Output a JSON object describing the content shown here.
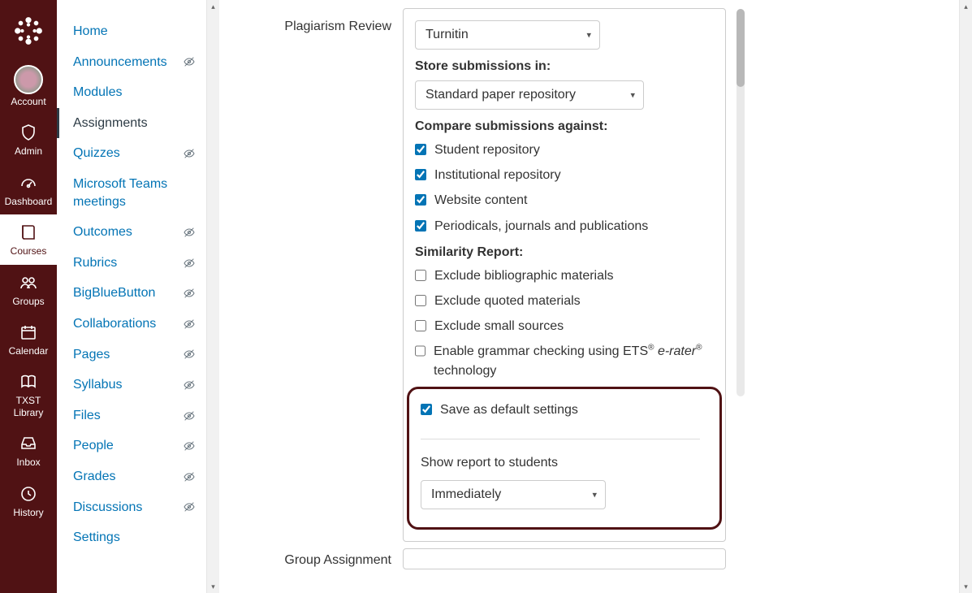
{
  "global_nav": {
    "items": [
      {
        "key": "account",
        "label": "Account"
      },
      {
        "key": "admin",
        "label": "Admin"
      },
      {
        "key": "dashboard",
        "label": "Dashboard"
      },
      {
        "key": "courses",
        "label": "Courses",
        "active": true
      },
      {
        "key": "groups",
        "label": "Groups"
      },
      {
        "key": "calendar",
        "label": "Calendar"
      },
      {
        "key": "library",
        "label": "TXST\nLibrary"
      },
      {
        "key": "inbox",
        "label": "Inbox"
      },
      {
        "key": "history",
        "label": "History"
      }
    ]
  },
  "course_nav": [
    {
      "label": "Home",
      "hidden": false
    },
    {
      "label": "Announcements",
      "hidden": true
    },
    {
      "label": "Modules",
      "hidden": false
    },
    {
      "label": "Assignments",
      "hidden": false,
      "active": true
    },
    {
      "label": "Quizzes",
      "hidden": true
    },
    {
      "label": "Microsoft Teams meetings",
      "hidden": false
    },
    {
      "label": "Outcomes",
      "hidden": true
    },
    {
      "label": "Rubrics",
      "hidden": true
    },
    {
      "label": "BigBlueButton",
      "hidden": true
    },
    {
      "label": "Collaborations",
      "hidden": true
    },
    {
      "label": "Pages",
      "hidden": true
    },
    {
      "label": "Syllabus",
      "hidden": true
    },
    {
      "label": "Files",
      "hidden": true
    },
    {
      "label": "People",
      "hidden": true
    },
    {
      "label": "Grades",
      "hidden": true
    },
    {
      "label": "Discussions",
      "hidden": true
    },
    {
      "label": "Settings",
      "hidden": false
    }
  ],
  "form": {
    "plagiarism_label": "Plagiarism Review",
    "plagiarism_select": "Turnitin",
    "store_label": "Store submissions in:",
    "store_select": "Standard paper repository",
    "compare_label": "Compare submissions against:",
    "compare_options": [
      {
        "label": "Student repository",
        "checked": true
      },
      {
        "label": "Institutional repository",
        "checked": true
      },
      {
        "label": "Website content",
        "checked": true
      },
      {
        "label": "Periodicals, journals and publications",
        "checked": true
      }
    ],
    "similarity_label": "Similarity Report:",
    "similarity_options": [
      {
        "label": "Exclude bibliographic materials",
        "checked": false
      },
      {
        "label": "Exclude quoted materials",
        "checked": false
      },
      {
        "label": "Exclude small sources",
        "checked": false
      }
    ],
    "grammar_pre": "Enable grammar checking using ETS",
    "grammar_mid": "e-rater",
    "grammar_post": "technology",
    "grammar_checked": false,
    "save_default_label": "Save as default settings",
    "save_default_checked": true,
    "show_report_label": "Show report to students",
    "show_report_select": "Immediately",
    "group_label": "Group Assignment"
  }
}
